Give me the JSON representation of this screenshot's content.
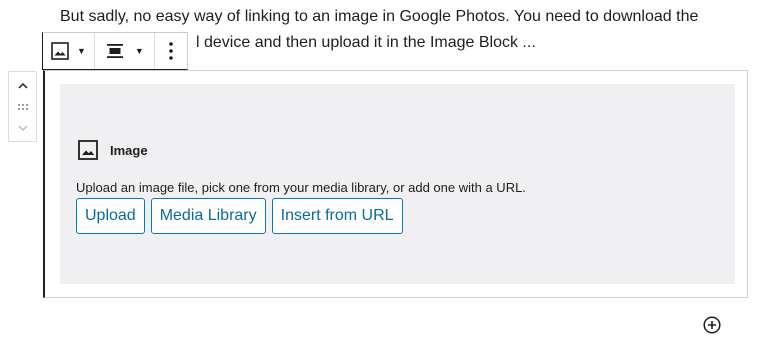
{
  "paragraph": {
    "line1": "But sadly, no easy way of linking to an image in Google Photos. You need to download the",
    "line2_visible": "l device and then upload it in the Image Block ..."
  },
  "toolbar": {
    "block_type_icon": "image-icon",
    "align_icon": "align-center-icon",
    "more_icon": "more-vertical-icon",
    "dropdown_icon": "caret-down-icon"
  },
  "mover": {
    "up_icon": "chevron-up-icon",
    "drag_icon": "drag-handle-icon",
    "down_icon": "chevron-down-icon"
  },
  "placeholder": {
    "label": "Image",
    "label_icon": "image-icon",
    "instructions": "Upload an image file, pick one from your media library, or add one with a URL.",
    "buttons": {
      "upload": "Upload",
      "media_library": "Media Library",
      "insert_url": "Insert from URL"
    }
  },
  "inserter": {
    "icon": "plus-circle-icon"
  },
  "colors": {
    "accent": "#007cba",
    "button_text": "#0a6b9c",
    "placeholder_bg": "#f0f0f2",
    "text": "#1e1e1e"
  }
}
